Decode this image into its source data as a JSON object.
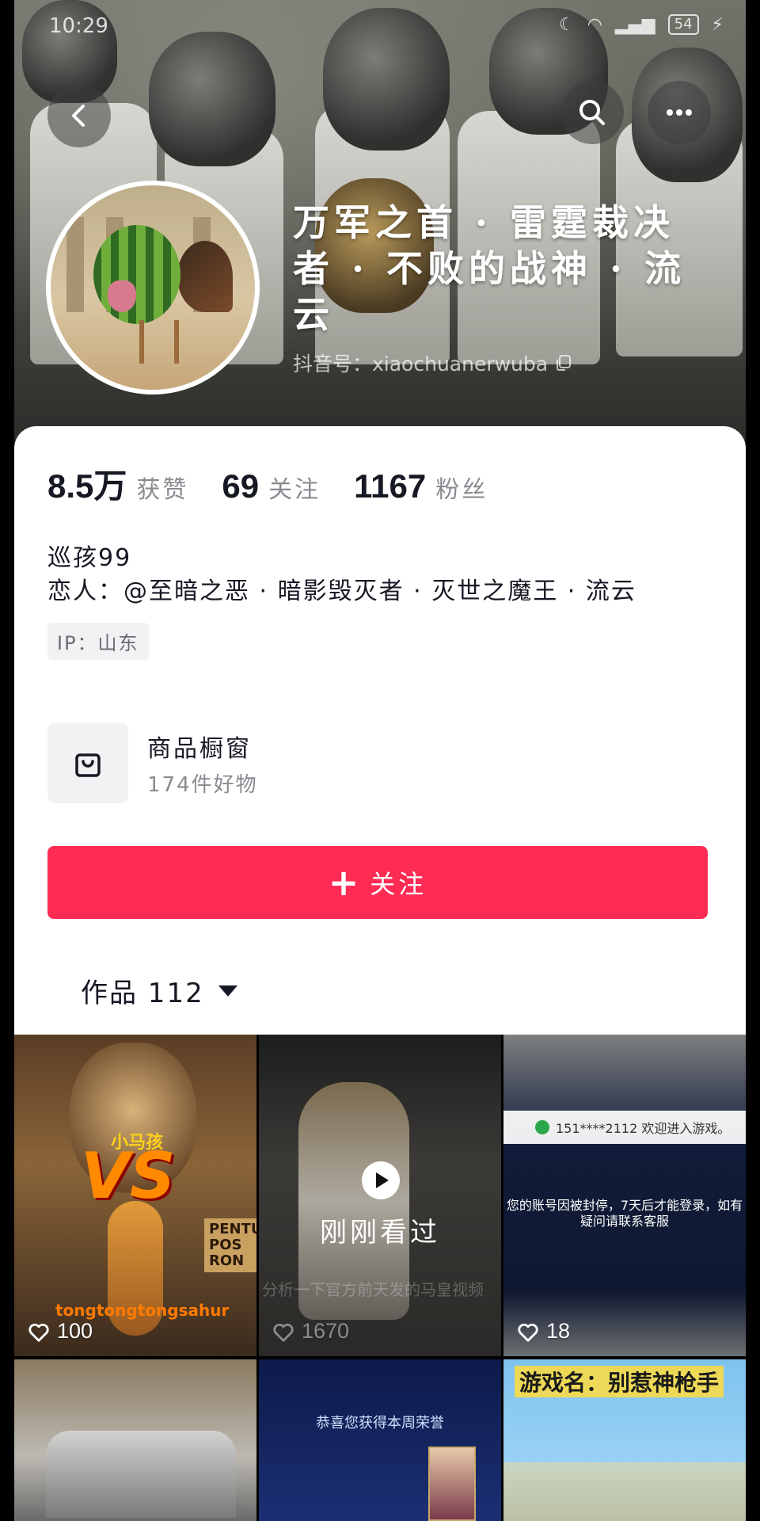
{
  "status_bar": {
    "time": "10:29",
    "battery": "54"
  },
  "header": {
    "nickname": "万军之首 · 雷霆裁决者 · 不败的战神 · 流云",
    "douyin_id": "抖音号：xiaochuanerwuba"
  },
  "stats": {
    "likes_value": "8.5万",
    "likes_label": "获赞",
    "following_value": "69",
    "following_label": "关注",
    "followers_value": "1167",
    "followers_label": "粉丝"
  },
  "bio": {
    "line1": "巡孩99",
    "line2": "恋人：@至暗之恶 · 暗影毁灭者 · 灭世之魔王 · 流云",
    "ip": "IP：山东"
  },
  "shop": {
    "title": "商品橱窗",
    "subtitle": "174件好物"
  },
  "follow_button": {
    "plus": "+",
    "label": "关注"
  },
  "works_tab": {
    "label": "作品 112"
  },
  "videos": [
    {
      "likes": "100",
      "tag": "小马孩",
      "vs": "VS",
      "name": "tongtongtongsahur",
      "sign": "PENTUNG POS RON"
    },
    {
      "likes": "1670",
      "watched": "刚刚看过",
      "subtitle": "分析一下官方前天发的马皇视频"
    },
    {
      "likes": "18",
      "toast": "151****2112 欢迎进入游戏。",
      "banned": "您的账号因被封停，7天后才能登录，如有疑问请联系客服"
    },
    {},
    {
      "congrats": "恭喜您获得本周荣誉"
    },
    {
      "game_name": "游戏名：别惹神枪手"
    }
  ],
  "colors": {
    "accent": "#fe2c55",
    "text_primary": "#161823",
    "text_secondary": "#8a8b91"
  }
}
